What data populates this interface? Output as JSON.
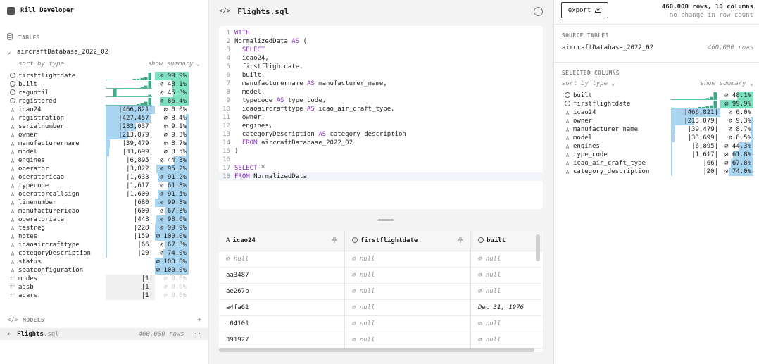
{
  "app": {
    "name": "Rill Developer"
  },
  "sidebar": {
    "tables_label": "TABLES",
    "table": {
      "name": "aircraftDatabase_2022_02"
    },
    "sort_label": "sort by type",
    "summary_label": "show summary",
    "columns": [
      {
        "type": "clock",
        "name": "firstflightdate",
        "card": "",
        "null": "∅ 99.9%",
        "null_frac": 0.999,
        "card_frac": 0,
        "hist": [
          0,
          0,
          0,
          0,
          0,
          0,
          0,
          1,
          1,
          2,
          3,
          9
        ],
        "bar": "t"
      },
      {
        "type": "clock",
        "name": "built",
        "card": "",
        "null": "∅ 48.1%",
        "null_frac": 0.481,
        "card_frac": 0,
        "hist": [
          0,
          0,
          0,
          0,
          0,
          0,
          0,
          0,
          0,
          1,
          2,
          6
        ],
        "bar": "t"
      },
      {
        "type": "clock",
        "name": "reguntil",
        "card": "",
        "null": "∅ 45.3%",
        "null_frac": 0.453,
        "card_frac": 0,
        "hist": [
          0,
          0,
          8,
          0,
          0,
          0,
          0,
          0,
          0,
          0,
          0,
          2
        ],
        "bar": "t"
      },
      {
        "type": "clock",
        "name": "registered",
        "card": "",
        "null": "∅ 86.4%",
        "null_frac": 0.864,
        "card_frac": 0,
        "hist": [
          0,
          0,
          0,
          0,
          0,
          0,
          0,
          0,
          1,
          2,
          4,
          9
        ],
        "bar": "t"
      },
      {
        "type": "A",
        "name": "icao24",
        "card": "|466,821|",
        "null": "∅ 0.0%",
        "null_frac": 0,
        "card_frac": 1.0,
        "bar": "b"
      },
      {
        "type": "A",
        "name": "registration",
        "card": "|427,457|",
        "null": "∅ 8.4%",
        "null_frac": 0.084,
        "card_frac": 0.92,
        "bar": "b"
      },
      {
        "type": "A",
        "name": "serialnumber",
        "card": "|283,037|",
        "null": "∅ 9.1%",
        "null_frac": 0.091,
        "card_frac": 0.61,
        "bar": "b"
      },
      {
        "type": "A",
        "name": "owner",
        "card": "|213,079|",
        "null": "∅ 9.3%",
        "null_frac": 0.093,
        "card_frac": 0.46,
        "bar": "b"
      },
      {
        "type": "A",
        "name": "manufacturername",
        "card": "|39,479|",
        "null": "∅ 8.7%",
        "null_frac": 0.087,
        "card_frac": 0.085,
        "bar": "b"
      },
      {
        "type": "A",
        "name": "model",
        "card": "|33,699|",
        "null": "∅ 8.5%",
        "null_frac": 0.085,
        "card_frac": 0.072,
        "bar": "b"
      },
      {
        "type": "A",
        "name": "engines",
        "card": "|6,895|",
        "null": "∅ 44.3%",
        "null_frac": 0.443,
        "card_frac": 0.015,
        "bar": "b"
      },
      {
        "type": "A",
        "name": "operator",
        "card": "|3,822|",
        "null": "∅ 95.2%",
        "null_frac": 0.952,
        "card_frac": 0.008,
        "bar": "b"
      },
      {
        "type": "A",
        "name": "operatoricao",
        "card": "|1,633|",
        "null": "∅ 91.2%",
        "null_frac": 0.912,
        "card_frac": 0.004,
        "bar": "b"
      },
      {
        "type": "A",
        "name": "typecode",
        "card": "|1,617|",
        "null": "∅ 61.8%",
        "null_frac": 0.618,
        "card_frac": 0.004,
        "bar": "b"
      },
      {
        "type": "A",
        "name": "operatorcallsign",
        "card": "|1,600|",
        "null": "∅ 91.5%",
        "null_frac": 0.915,
        "card_frac": 0.004,
        "bar": "b"
      },
      {
        "type": "A",
        "name": "linenumber",
        "card": "|680|",
        "null": "∅ 99.8%",
        "null_frac": 0.998,
        "card_frac": 0.002,
        "bar": "b"
      },
      {
        "type": "A",
        "name": "manufacturericao",
        "card": "|600|",
        "null": "∅ 67.8%",
        "null_frac": 0.678,
        "card_frac": 0.002,
        "bar": "b"
      },
      {
        "type": "A",
        "name": "operatoriata",
        "card": "|448|",
        "null": "∅ 98.6%",
        "null_frac": 0.986,
        "card_frac": 0.001,
        "bar": "b"
      },
      {
        "type": "A",
        "name": "testreg",
        "card": "|228|",
        "null": "∅ 99.9%",
        "null_frac": 0.999,
        "card_frac": 0.0005,
        "bar": "b"
      },
      {
        "type": "A",
        "name": "notes",
        "card": "|159|",
        "null": "∅ 100.0%",
        "null_frac": 1.0,
        "card_frac": 0.0003,
        "bar": "b"
      },
      {
        "type": "A",
        "name": "icaoaircrafttype",
        "card": "|66|",
        "null": "∅ 67.8%",
        "null_frac": 0.678,
        "card_frac": 0.0001,
        "bar": "b"
      },
      {
        "type": "A",
        "name": "categoryDescription",
        "card": "|20|",
        "null": "∅ 74.0%",
        "null_frac": 0.74,
        "card_frac": 0.0001,
        "bar": "b"
      },
      {
        "type": "A",
        "name": "status",
        "card": "",
        "null": "∅ 100.0%",
        "null_frac": 1.0,
        "card_frac": 0,
        "bar": "b"
      },
      {
        "type": "A",
        "name": "seatconfiguration",
        "card": "",
        "null": "∅ 100.0%",
        "null_frac": 1.0,
        "card_frac": 0,
        "bar": "b"
      },
      {
        "type": "TF",
        "name": "modes",
        "card": "|1|",
        "null": "∅ 0.0%",
        "null_frac": 0,
        "card_frac": 0,
        "bar": "g",
        "faded": true
      },
      {
        "type": "TF",
        "name": "adsb",
        "card": "|1|",
        "null": "∅ 0.0%",
        "null_frac": 0,
        "card_frac": 0,
        "bar": "g",
        "faded": true
      },
      {
        "type": "TF",
        "name": "acars",
        "card": "|1|",
        "null": "∅ 0.0%",
        "null_frac": 0,
        "card_frac": 0,
        "bar": "g",
        "faded": true
      }
    ],
    "models_label": "MODELS",
    "add_label": "+",
    "model": {
      "name": "Flights",
      "ext": ".sql",
      "rows": "460,000 rows",
      "more": "···"
    }
  },
  "editor": {
    "title": "Flights.sql",
    "lines": [
      [
        {
          "k": 1,
          "t": "WITH"
        }
      ],
      [
        {
          "t": "NormalizedData "
        },
        {
          "k": 1,
          "t": "AS"
        },
        {
          "t": " ("
        }
      ],
      [
        {
          "t": "  "
        },
        {
          "k": 1,
          "t": "SELECT"
        }
      ],
      [
        {
          "t": "  icao24,"
        }
      ],
      [
        {
          "t": "  firstflightdate,"
        }
      ],
      [
        {
          "t": "  built,"
        }
      ],
      [
        {
          "t": "  manufacturername "
        },
        {
          "k": 1,
          "t": "AS"
        },
        {
          "t": " manufacturer_name,"
        }
      ],
      [
        {
          "t": "  model,"
        }
      ],
      [
        {
          "t": "  typecode "
        },
        {
          "k": 1,
          "t": "AS"
        },
        {
          "t": " type_code,"
        }
      ],
      [
        {
          "t": "  icaoaircrafttype "
        },
        {
          "k": 1,
          "t": "AS"
        },
        {
          "t": " icao_air_craft_type,"
        }
      ],
      [
        {
          "t": "  owner,"
        }
      ],
      [
        {
          "t": "  engines,"
        }
      ],
      [
        {
          "t": "  categoryDescription "
        },
        {
          "k": 1,
          "t": "AS"
        },
        {
          "t": " category_description"
        }
      ],
      [
        {
          "t": "  "
        },
        {
          "k": 1,
          "t": "FROM"
        },
        {
          "t": " aircraftDatabase_2022_02"
        }
      ],
      [
        {
          "t": ")"
        }
      ],
      [
        {
          "t": ""
        }
      ],
      [
        {
          "k": 1,
          "t": "SELECT"
        },
        {
          "t": " *"
        }
      ],
      [
        {
          "k": 1,
          "t": "FROM"
        },
        {
          "t": " NormalizedData"
        }
      ]
    ]
  },
  "results": {
    "headers": [
      {
        "type": "A",
        "name": "icao24"
      },
      {
        "type": "clock",
        "name": "firstflightdate"
      },
      {
        "type": "clock",
        "name": "built"
      }
    ],
    "rows": [
      [
        "∅ null",
        "∅ null",
        "∅ null"
      ],
      [
        "aa3487",
        "∅ null",
        "∅ null"
      ],
      [
        "ae267b",
        "∅ null",
        "∅ null"
      ],
      [
        "a4fa61",
        "∅ null",
        "Dec 31, 1976"
      ],
      [
        "c04101",
        "∅ null",
        "∅ null"
      ],
      [
        "391927",
        "∅ null",
        "∅ null"
      ]
    ]
  },
  "right": {
    "export_label": "export",
    "rows_info": "460,000 rows, 10 columns",
    "row_change": "no change in row count",
    "source_tables_label": "SOURCE TABLES",
    "source_table": {
      "name": "aircraftDatabase_2022_02",
      "rows": "460,000 rows"
    },
    "selected_columns_label": "SELECTED COLUMNS",
    "sort_label": "sort by type",
    "summary_label": "show summary",
    "columns": [
      {
        "type": "clock",
        "name": "built",
        "card": "",
        "null": "∅ 48.1%",
        "null_frac": 0.481,
        "card_frac": 0,
        "hist": [
          0,
          0,
          0,
          0,
          0,
          0,
          0,
          0,
          0,
          1,
          2,
          6
        ],
        "bar": "t"
      },
      {
        "type": "clock",
        "name": "firstflightdate",
        "card": "",
        "null": "∅ 99.9%",
        "null_frac": 0.999,
        "card_frac": 0,
        "hist": [
          0,
          0,
          0,
          0,
          0,
          0,
          0,
          1,
          1,
          2,
          3,
          9
        ],
        "bar": "t"
      },
      {
        "type": "A",
        "name": "icao24",
        "card": "|466,821|",
        "null": "∅ 0.0%",
        "null_frac": 0,
        "card_frac": 1.0,
        "bar": "b"
      },
      {
        "type": "A",
        "name": "owner",
        "card": "|213,079|",
        "null": "∅ 9.3%",
        "null_frac": 0.093,
        "card_frac": 0.46,
        "bar": "b"
      },
      {
        "type": "A",
        "name": "manufacturer_name",
        "card": "|39,479|",
        "null": "∅ 8.7%",
        "null_frac": 0.087,
        "card_frac": 0.085,
        "bar": "b"
      },
      {
        "type": "A",
        "name": "model",
        "card": "|33,699|",
        "null": "∅ 8.5%",
        "null_frac": 0.085,
        "card_frac": 0.072,
        "bar": "b"
      },
      {
        "type": "A",
        "name": "engines",
        "card": "|6,895|",
        "null": "∅ 44.3%",
        "null_frac": 0.443,
        "card_frac": 0.015,
        "bar": "b"
      },
      {
        "type": "A",
        "name": "type_code",
        "card": "|1,617|",
        "null": "∅ 61.8%",
        "null_frac": 0.618,
        "card_frac": 0.004,
        "bar": "b"
      },
      {
        "type": "A",
        "name": "icao_air_craft_type",
        "card": "|66|",
        "null": "∅ 67.8%",
        "null_frac": 0.678,
        "card_frac": 0.0001,
        "bar": "b"
      },
      {
        "type": "A",
        "name": "category_description",
        "card": "|20|",
        "null": "∅ 74.0%",
        "null_frac": 0.74,
        "card_frac": 0.0001,
        "bar": "b"
      }
    ]
  },
  "colors": {
    "accent_blue": "#a9d4ef",
    "accent_teal": "#7ee1c2",
    "keyword": "#8a2fbf"
  }
}
